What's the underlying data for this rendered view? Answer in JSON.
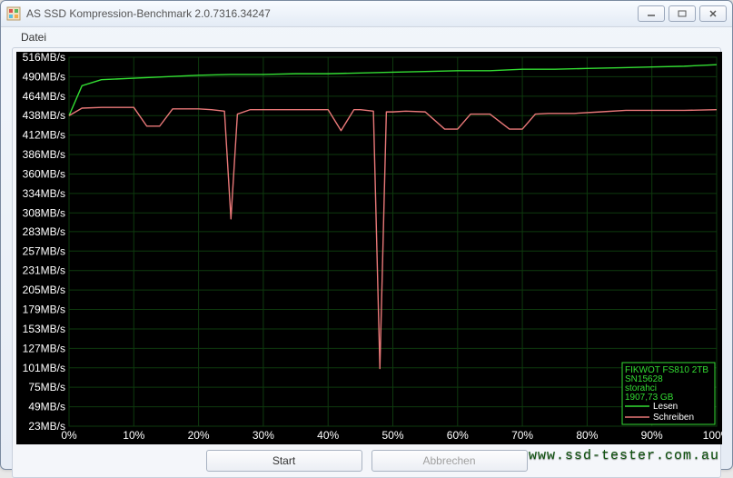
{
  "window": {
    "title": "AS SSD Kompression-Benchmark 2.0.7316.34247"
  },
  "menu": {
    "datei": "Datei"
  },
  "buttons": {
    "start": "Start",
    "abort": "Abbrechen"
  },
  "watermark": "www.ssd-tester.com.au",
  "device_info": {
    "model": "FIKWOT FS810 2TB",
    "serial": "SN15628",
    "driver": "storahci",
    "size": "1907,73 GB"
  },
  "legend": {
    "read": "Lesen",
    "write": "Schreiben"
  },
  "chart_data": {
    "type": "line",
    "xlabel": "",
    "ylabel": "",
    "x_ticks": [
      "0%",
      "10%",
      "20%",
      "30%",
      "40%",
      "50%",
      "60%",
      "70%",
      "80%",
      "90%",
      "100%"
    ],
    "y_ticks_values": [
      23,
      49,
      75,
      101,
      127,
      153,
      179,
      205,
      231,
      257,
      283,
      308,
      334,
      360,
      386,
      412,
      438,
      464,
      490,
      516
    ],
    "y_unit": "MB/s",
    "xlim": [
      0,
      100
    ],
    "ylim": [
      23,
      516
    ],
    "series": [
      {
        "name": "Lesen",
        "color": "#33dd33",
        "x": [
          0,
          2,
          5,
          10,
          15,
          20,
          25,
          30,
          35,
          40,
          45,
          50,
          55,
          60,
          65,
          70,
          75,
          80,
          85,
          90,
          95,
          100
        ],
        "y": [
          438,
          478,
          486,
          488,
          490,
          492,
          493,
          493,
          494,
          494,
          495,
          496,
          497,
          498,
          498,
          500,
          500,
          501,
          502,
          503,
          504,
          506
        ]
      },
      {
        "name": "Schreiben",
        "color": "#e97878",
        "x": [
          0,
          2,
          5,
          10,
          12,
          14,
          16,
          20,
          22,
          24,
          25,
          26,
          28,
          30,
          35,
          40,
          42,
          44,
          45,
          47,
          48,
          49,
          50,
          52,
          55,
          58,
          60,
          62,
          65,
          68,
          70,
          72,
          74,
          78,
          82,
          86,
          90,
          95,
          100
        ],
        "y": [
          438,
          448,
          449,
          449,
          424,
          424,
          447,
          447,
          446,
          444,
          300,
          440,
          446,
          446,
          446,
          446,
          418,
          446,
          446,
          444,
          100,
          443,
          443,
          444,
          443,
          420,
          420,
          440,
          440,
          420,
          420,
          440,
          441,
          441,
          443,
          445,
          445,
          445,
          446
        ]
      }
    ]
  }
}
